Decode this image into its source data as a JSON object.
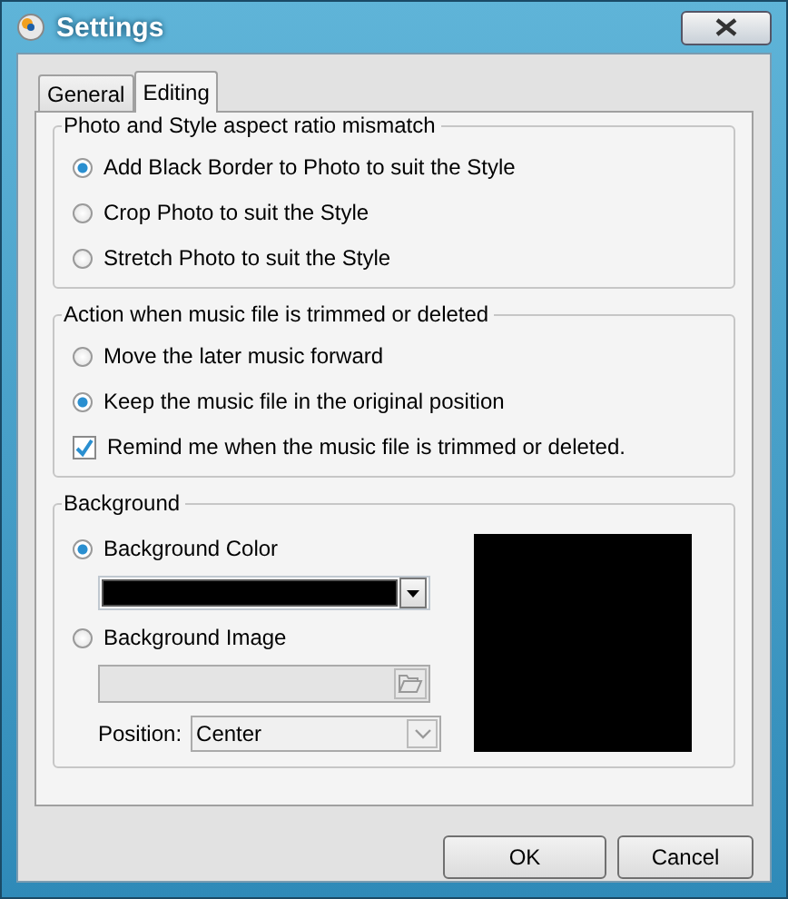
{
  "window": {
    "title": "Settings"
  },
  "tabs": [
    {
      "label": "General",
      "selected": false
    },
    {
      "label": "Editing",
      "selected": true
    }
  ],
  "groups": [
    {
      "title": "Photo and Style aspect ratio mismatch",
      "items": [
        {
          "kind": "radio",
          "label": "Add Black Border to Photo to suit the Style",
          "selected": true
        },
        {
          "kind": "radio",
          "label": "Crop Photo to suit the Style",
          "selected": false
        },
        {
          "kind": "radio",
          "label": "Stretch Photo to suit the Style",
          "selected": false
        }
      ]
    },
    {
      "title": "Action when music file is trimmed or deleted",
      "items": [
        {
          "kind": "radio",
          "label": "Move the later music forward",
          "selected": false
        },
        {
          "kind": "radio",
          "label": "Keep the music file in the original position",
          "selected": true
        },
        {
          "kind": "checkbox",
          "label": "Remind me when the music file is trimmed or deleted.",
          "checked": true
        }
      ]
    }
  ],
  "background": {
    "title": "Background",
    "options": [
      {
        "label": "Background Color",
        "selected": true
      },
      {
        "label": "Background Image",
        "selected": false
      }
    ],
    "color": "#000000",
    "position_label": "Position:",
    "position": "Center"
  },
  "buttons": [
    "OK",
    "Cancel"
  ]
}
